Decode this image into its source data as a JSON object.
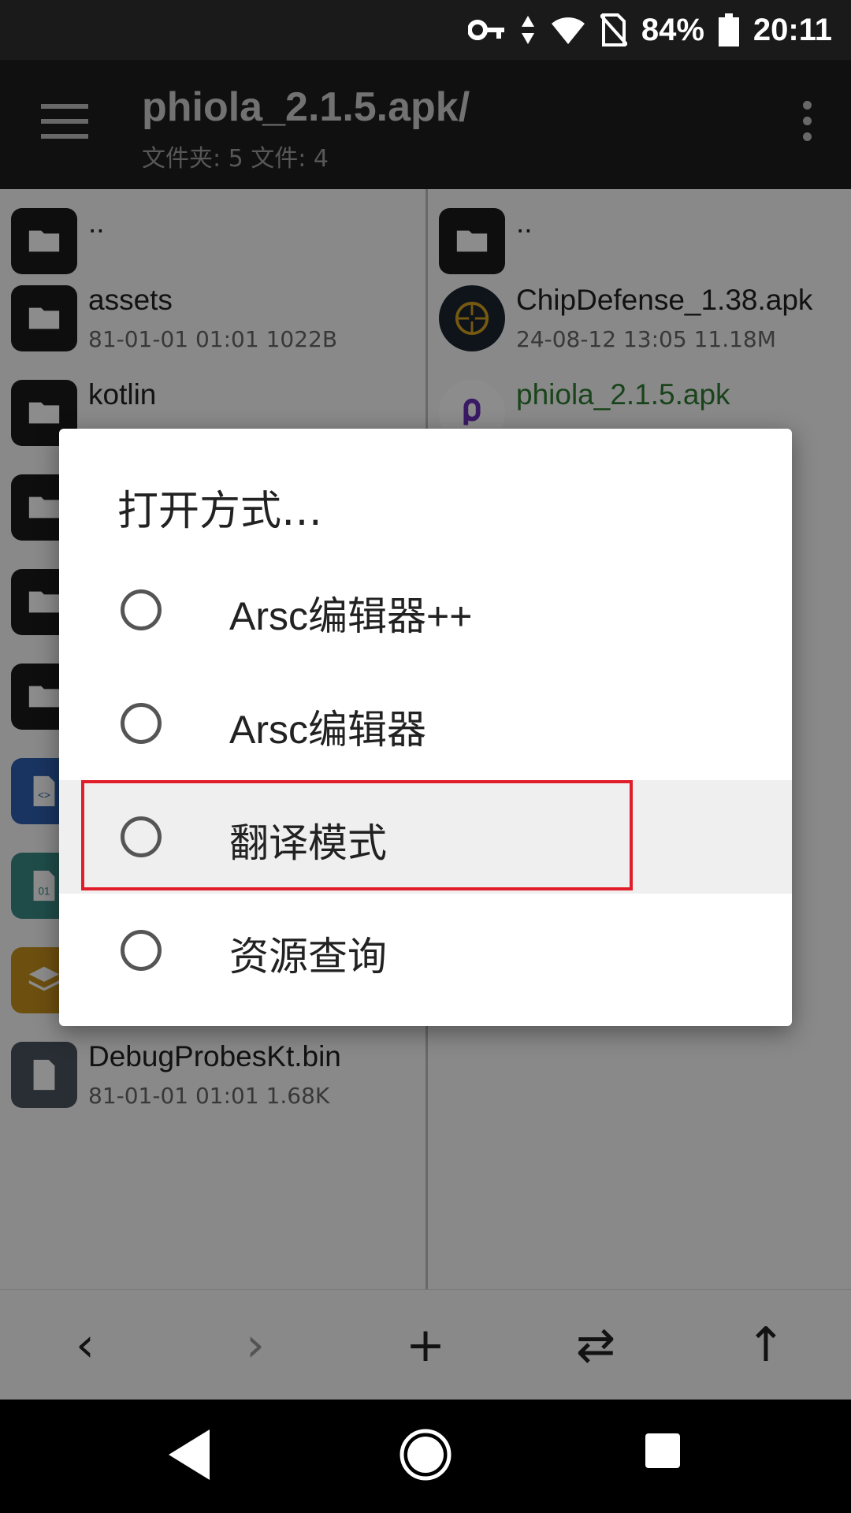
{
  "status_bar": {
    "battery": "84%",
    "time": "20:11"
  },
  "app_bar": {
    "title": "phiola_2.1.5.apk/",
    "subtitle": "文件夹: 5  文件: 4"
  },
  "left_pane": {
    "items": [
      {
        "name": "..",
        "meta": "",
        "icon": "folder-icon"
      },
      {
        "name": "assets",
        "meta": "81-01-01 01:01  1022B",
        "icon": "folder-icon"
      },
      {
        "name": "kotlin",
        "meta": "",
        "icon": "folder-icon"
      },
      {
        "name": "",
        "meta": "",
        "icon": "folder-icon"
      },
      {
        "name": "",
        "meta": "",
        "icon": "folder-icon"
      },
      {
        "name": "",
        "meta": "",
        "icon": "folder-icon"
      },
      {
        "name": "",
        "meta": "",
        "icon": "xml-file-icon"
      },
      {
        "name": "",
        "meta": "",
        "icon": "binary-file-icon"
      },
      {
        "name": "",
        "meta": "",
        "icon": "layers-file-icon"
      },
      {
        "name": "DebugProbesKt.bin",
        "meta": "81-01-01 01:01  1.68K",
        "icon": "file-icon"
      }
    ]
  },
  "right_pane": {
    "items": [
      {
        "name": "..",
        "meta": "",
        "icon": "folder-icon"
      },
      {
        "name": "ChipDefense_1.38.apk",
        "meta": "24-08-12 13:05  11.18M",
        "icon": "chipdefense-app-icon"
      },
      {
        "name": "phiola_2.1.5.apk",
        "meta": "",
        "icon": "phiola-app-icon"
      }
    ]
  },
  "dialog": {
    "title": "打开方式…",
    "options": [
      {
        "label": "Arsc编辑器++"
      },
      {
        "label": "Arsc编辑器"
      },
      {
        "label": "翻译模式",
        "highlighted": true
      },
      {
        "label": "资源查询"
      }
    ]
  },
  "toolbar": {
    "back": "‹",
    "forward": "›",
    "add": "+",
    "swap": "⇄",
    "up": "↑"
  },
  "colors": {
    "highlight_border": "#e11d2a",
    "selected_file": "#2e7d32"
  }
}
